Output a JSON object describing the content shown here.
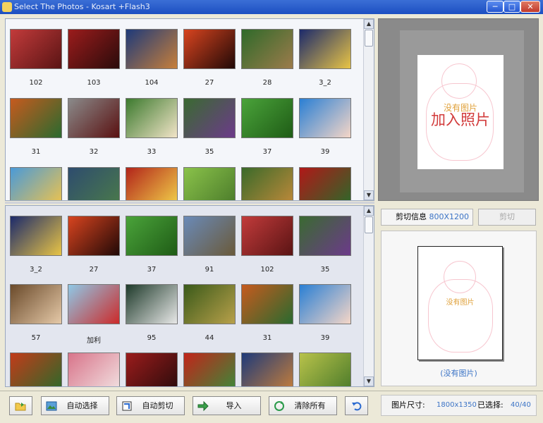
{
  "window": {
    "title": "Select The Photos - Kosart +Flash3",
    "minimize": "─",
    "restore": "□",
    "close": "✕"
  },
  "source_photos": [
    {
      "label": "102",
      "c1": "#c23b3b",
      "c2": "#5a1414"
    },
    {
      "label": "103",
      "c1": "#9b1c1c",
      "c2": "#2a0b0b"
    },
    {
      "label": "104",
      "c1": "#1e3a7a",
      "c2": "#c77f3a"
    },
    {
      "label": "27",
      "c1": "#d8441f",
      "c2": "#210907"
    },
    {
      "label": "28",
      "c1": "#2f6a2a",
      "c2": "#9c7b4b"
    },
    {
      "label": "3_2",
      "c1": "#1c2a6b",
      "c2": "#e8c446"
    },
    {
      "label": "31",
      "c1": "#c65a1e",
      "c2": "#2a6a2f"
    },
    {
      "label": "32",
      "c1": "#8a8a8a",
      "c2": "#5a1111"
    },
    {
      "label": "33",
      "c1": "#3c7a2e",
      "c2": "#f2e4c8"
    },
    {
      "label": "35",
      "c1": "#3a6a31",
      "c2": "#6c3a8a"
    },
    {
      "label": "37",
      "c1": "#4aa33a",
      "c2": "#1f5c16"
    },
    {
      "label": "39",
      "c1": "#2a7fd4",
      "c2": "#f5d6c7"
    },
    {
      "label": "",
      "c1": "#4a9ad8",
      "c2": "#f1c44a"
    },
    {
      "label": "",
      "c1": "#2e4c6e",
      "c2": "#4a7a4a"
    },
    {
      "label": "",
      "c1": "#b2241a",
      "c2": "#f2d34a"
    },
    {
      "label": "",
      "c1": "#8ac24a",
      "c2": "#4a7a2a"
    },
    {
      "label": "",
      "c1": "#3a6a2a",
      "c2": "#c28a3a"
    },
    {
      "label": "",
      "c1": "#b01818",
      "c2": "#2a6a2a"
    }
  ],
  "selected_photos": [
    {
      "label": "3_2",
      "c1": "#1c2a6b",
      "c2": "#e8c446"
    },
    {
      "label": "27",
      "c1": "#d8441f",
      "c2": "#210907"
    },
    {
      "label": "37",
      "c1": "#4aa33a",
      "c2": "#1f5c16"
    },
    {
      "label": "91",
      "c1": "#6a8ab8",
      "c2": "#6a5a3a"
    },
    {
      "label": "102",
      "c1": "#c23b3b",
      "c2": "#5a1414"
    },
    {
      "label": "35",
      "c1": "#3a6a31",
      "c2": "#6c3a8a"
    },
    {
      "label": "57",
      "c1": "#6a4a2a",
      "c2": "#e5c9a8"
    },
    {
      "label": "加利",
      "c1": "#8fc8e6",
      "c2": "#cc2a2a"
    },
    {
      "label": "95",
      "c1": "#1e3a2a",
      "c2": "#e8e8e8"
    },
    {
      "label": "44",
      "c1": "#3a5a1a",
      "c2": "#b8a04a"
    },
    {
      "label": "31",
      "c1": "#c65a1e",
      "c2": "#2a6a2f"
    },
    {
      "label": "39",
      "c1": "#2a7fd4",
      "c2": "#f5d6c7"
    },
    {
      "label": "",
      "c1": "#c23b1a",
      "c2": "#2a6a2a"
    },
    {
      "label": "",
      "c1": "#d8748a",
      "c2": "#f2e2e2"
    },
    {
      "label": "",
      "c1": "#9b1c1c",
      "c2": "#2a0b0b"
    },
    {
      "label": "",
      "c1": "#c2241a",
      "c2": "#3a8a3a"
    },
    {
      "label": "",
      "c1": "#1e3a7a",
      "c2": "#c77f3a"
    },
    {
      "label": "",
      "c1": "#b8c24a",
      "c2": "#4a7a2a"
    }
  ],
  "preview": {
    "no_photo": "没有图片",
    "add_photo": "加入照片"
  },
  "crop": {
    "info_label": "剪切信息",
    "info_size": "800X1200",
    "button": "剪切"
  },
  "print_preview": {
    "no_photo": "没有图片",
    "caption": "(没有图片)"
  },
  "toolbar": {
    "auto_select": "自动选择",
    "auto_crop": "自动剪切",
    "import": "导入",
    "clear_all": "清除所有"
  },
  "status": {
    "size_label": "图片尺寸:",
    "size_value": "1800x1350",
    "selected_label": "已选择:",
    "selected_value": "40/40"
  },
  "colors": {
    "accent_blue": "#3c74c6",
    "add_photo_red": "#d23b3b",
    "no_photo_orange": "#e0a13a"
  }
}
